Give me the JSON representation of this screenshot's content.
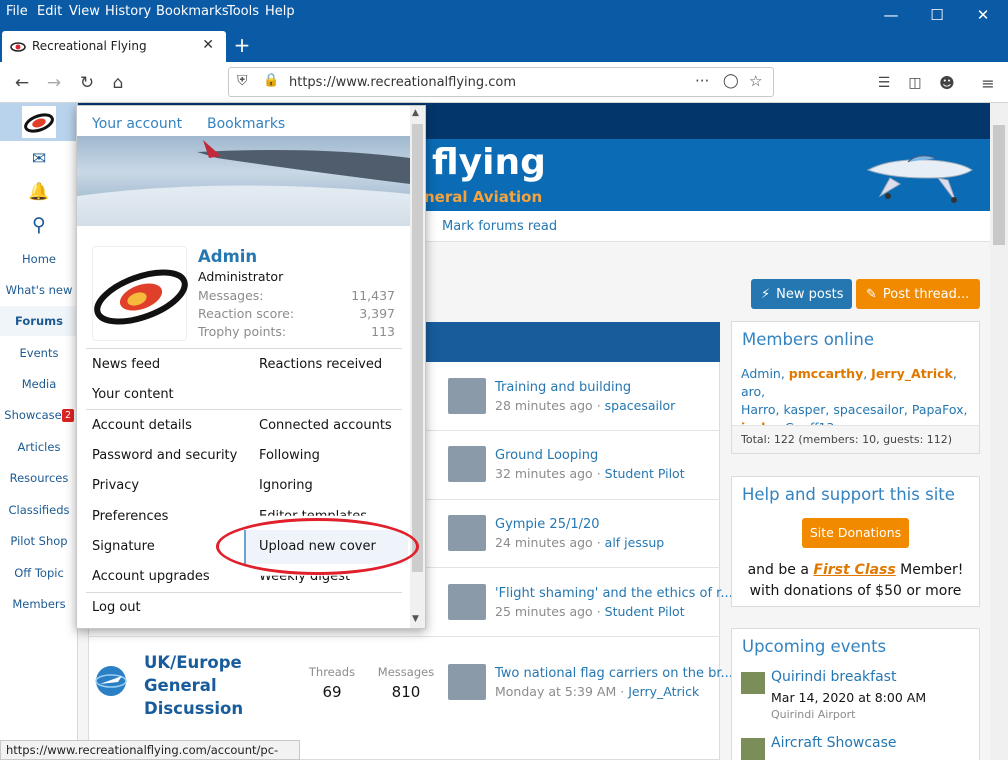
{
  "menubar": {
    "items": [
      "File",
      "Edit",
      "View",
      "History",
      "Bookmarks",
      "Tools",
      "Help"
    ]
  },
  "tab": {
    "title": "Recreational Flying"
  },
  "navbar": {
    "url": "https://www.recreationalflying.com"
  },
  "site": {
    "name": "flying",
    "subtitle": "neral Aviation",
    "mark_read": "Mark forums read"
  },
  "sidebar": {
    "items": [
      {
        "label": "Home"
      },
      {
        "label": "What's new"
      },
      {
        "label": "Forums"
      },
      {
        "label": "Events"
      },
      {
        "label": "Media"
      },
      {
        "label": "Showcase",
        "badge": "2"
      },
      {
        "label": "Articles"
      },
      {
        "label": "Resources"
      },
      {
        "label": "Classifieds"
      },
      {
        "label": "Pilot Shop"
      },
      {
        "label": "Off Topic"
      },
      {
        "label": "Members"
      }
    ]
  },
  "buttons": {
    "new_posts": "New posts",
    "post_thread": "Post thread..."
  },
  "threads": [
    {
      "title": "Training and building",
      "time": "28 minutes ago",
      "sep": "·",
      "user": "spacesailor"
    },
    {
      "title": "Ground Looping",
      "time": "32 minutes ago",
      "sep": "·",
      "user": "Student Pilot"
    },
    {
      "title": "Gympie 25/1/20",
      "time": "24 minutes ago",
      "sep": "·",
      "user": "alf jessup"
    },
    {
      "title": "'Flight shaming' and the ethics of r...",
      "time": "25 minutes ago",
      "sep": "·",
      "user": "Student Pilot"
    },
    {
      "title": "Two national flag carriers on the br...",
      "time": "Monday at 5:39 AM",
      "sep": "·",
      "user": "Jerry_Atrick"
    }
  ],
  "forum": {
    "name_l1": "UK/Europe",
    "name_l2": "General",
    "name_l3": "Discussion",
    "threads_label": "Threads",
    "threads": "69",
    "messages_label": "Messages",
    "messages": "810"
  },
  "members_online": {
    "title": "Members online",
    "line1": [
      "Admin",
      "pmccarthy",
      "Jerry_Atrick",
      "aro,"
    ],
    "line2": "Harro, kasper, spacesailor, PapaFox,",
    "line3a": "jackc",
    "line3b": ", Geoff13",
    "total": "Total: 122 (members: 10, guests: 112)"
  },
  "help": {
    "title": "Help and support this site",
    "button": "Site Donations",
    "line1a": "and be a ",
    "line1b": "First Class",
    "line1c": " Member!",
    "line2": "with donations of $50 or more"
  },
  "events": {
    "title": "Upcoming events",
    "e1_title": "Quirindi breakfast",
    "e1_date": "Mar 14, 2020 at 8:00 AM",
    "e1_place": "Quirindi Airport",
    "e2_title": "Aircraft Showcase"
  },
  "popup": {
    "tabs": [
      "Your account",
      "Bookmarks"
    ],
    "user": {
      "name": "Admin",
      "role": "Administrator"
    },
    "stats": [
      {
        "label": "Messages:",
        "value": "11,437"
      },
      {
        "label": "Reaction score:",
        "value": "3,397"
      },
      {
        "label": "Trophy points:",
        "value": "113"
      }
    ],
    "left": [
      "News feed",
      "Your content",
      "Account details",
      "Password and security",
      "Privacy",
      "Preferences",
      "Signature",
      "Account upgrades",
      "Log out"
    ],
    "right": [
      "Reactions received",
      "Connected accounts",
      "Following",
      "Ignoring",
      "Editor templates",
      "Upload new cover",
      "Weekly digest"
    ]
  },
  "statusbar": {
    "text": "https://www.recreationalflying.com/account/pc-cover"
  },
  "colors": {
    "brand": "#0a5aa6",
    "link": "#2577b1",
    "annotation": "#e0202b"
  }
}
